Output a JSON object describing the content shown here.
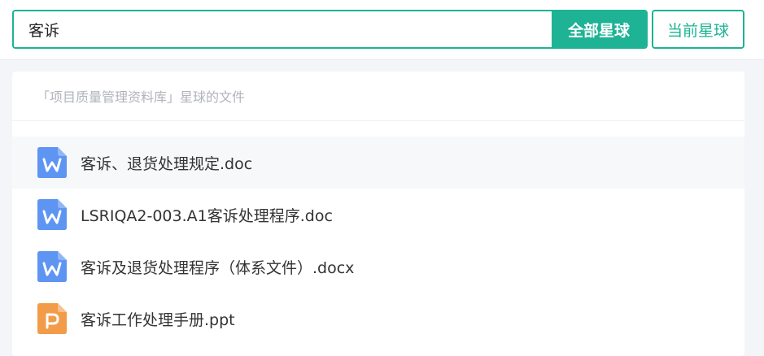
{
  "search": {
    "value": "客诉",
    "all_label": "全部星球",
    "current_label": "当前星球"
  },
  "results": {
    "section_title": "「项目质量管理资料库」星球的文件",
    "files": [
      {
        "name": "客诉、退货处理规定.doc",
        "icon": "word-file-icon"
      },
      {
        "name": "LSRIQA2-003.A1客诉处理程序.doc",
        "icon": "word-file-icon"
      },
      {
        "name": "客诉及退货处理程序（体系文件）.docx",
        "icon": "word-file-icon"
      },
      {
        "name": "客诉工作处理手册.ppt",
        "icon": "powerpoint-file-icon"
      }
    ]
  },
  "colors": {
    "accent": "#1db394",
    "word_icon": "#5e95f2",
    "ppt_icon": "#f29c4a"
  }
}
